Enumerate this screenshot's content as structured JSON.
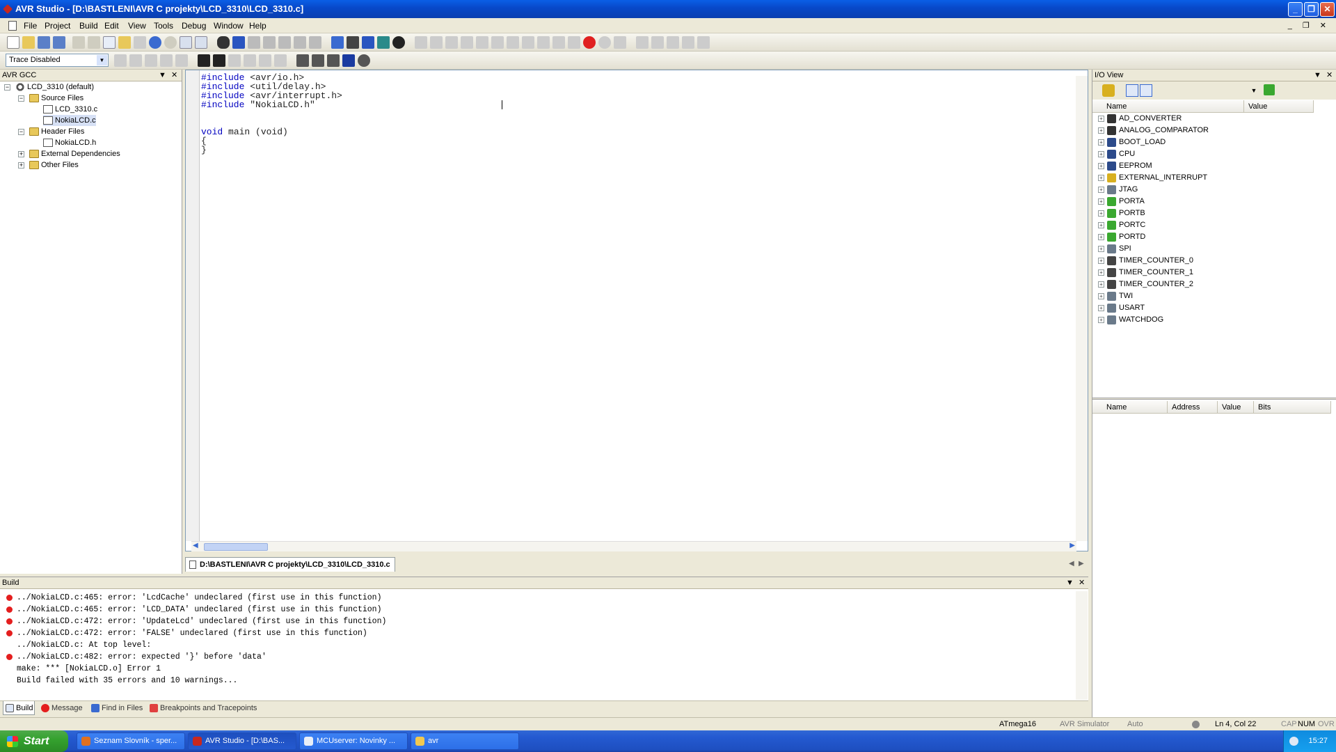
{
  "window": {
    "title": "AVR Studio - [D:\\BASTLENI\\AVR C projekty\\LCD_3310\\LCD_3310.c]",
    "min_label": "_",
    "max_label": "❐",
    "close_label": "✕"
  },
  "menu": [
    "File",
    "Project",
    "Build",
    "Edit",
    "View",
    "Tools",
    "Debug",
    "Window",
    "Help"
  ],
  "doc_controls": "_ ❐ ✕",
  "toolbar": {
    "trace_value": "Trace Disabled"
  },
  "left_panel": {
    "title": "AVR GCC",
    "tree": {
      "project": "LCD_3310 (default)",
      "source_folder": "Source Files",
      "source_files": [
        "LCD_3310.c",
        "NokiaLCD.c"
      ],
      "header_folder": "Header Files",
      "header_files": [
        "NokiaLCD.h"
      ],
      "external_deps": "External Dependencies",
      "other_files": "Other Files"
    }
  },
  "editor": {
    "lines": [
      {
        "kw": "#include",
        "rest": " <avr/io.h>"
      },
      {
        "kw": "#include",
        "rest": " <util/delay.h>"
      },
      {
        "kw": "#include",
        "rest": " <avr/interrupt.h>"
      },
      {
        "kw": "#include",
        "rest": " \"NokiaLCD.h\""
      },
      {
        "kw": "",
        "rest": ""
      },
      {
        "kw": "",
        "rest": ""
      },
      {
        "kw": "void",
        "rest": " main (void)"
      },
      {
        "kw": "",
        "rest": "{"
      },
      {
        "kw": "",
        "rest": "}"
      }
    ],
    "tab_label": "D:\\BASTLENI\\AVR C projekty\\LCD_3310\\LCD_3310.c"
  },
  "io_view": {
    "title": "I/O View",
    "col_name": "Name",
    "col_value": "Value",
    "items": [
      {
        "name": "AD_CONVERTER",
        "icon": "ad-converter-icon",
        "color": "#333333"
      },
      {
        "name": "ANALOG_COMPARATOR",
        "icon": "comparator-icon",
        "color": "#333333"
      },
      {
        "name": "BOOT_LOAD",
        "icon": "boot-load-icon",
        "color": "#2c4a8a"
      },
      {
        "name": "CPU",
        "icon": "cpu-icon",
        "color": "#2c4a8a"
      },
      {
        "name": "EEPROM",
        "icon": "eeprom-icon",
        "color": "#2c4a8a"
      },
      {
        "name": "EXTERNAL_INTERRUPT",
        "icon": "interrupt-icon",
        "color": "#d8b020"
      },
      {
        "name": "JTAG",
        "icon": "jtag-icon",
        "color": "#6a7a8a"
      },
      {
        "name": "PORTA",
        "icon": "port-icon",
        "color": "#3aa830"
      },
      {
        "name": "PORTB",
        "icon": "port-icon",
        "color": "#3aa830"
      },
      {
        "name": "PORTC",
        "icon": "port-icon",
        "color": "#3aa830"
      },
      {
        "name": "PORTD",
        "icon": "port-icon",
        "color": "#3aa830"
      },
      {
        "name": "SPI",
        "icon": "spi-icon",
        "color": "#6a7a8a"
      },
      {
        "name": "TIMER_COUNTER_0",
        "icon": "timer-icon",
        "color": "#444444"
      },
      {
        "name": "TIMER_COUNTER_1",
        "icon": "timer-icon",
        "color": "#444444"
      },
      {
        "name": "TIMER_COUNTER_2",
        "icon": "timer-icon",
        "color": "#444444"
      },
      {
        "name": "TWI",
        "icon": "twi-icon",
        "color": "#6a7a8a"
      },
      {
        "name": "USART",
        "icon": "usart-icon",
        "color": "#6a7a8a"
      },
      {
        "name": "WATCHDOG",
        "icon": "watchdog-icon",
        "color": "#6a7a8a"
      }
    ],
    "reg_cols": [
      "Name",
      "Address",
      "Value",
      "Bits"
    ]
  },
  "build": {
    "title": "Build",
    "lines": [
      {
        "error": true,
        "text": "../NokiaLCD.c:465: error: 'LcdCache' undeclared (first use in this function)"
      },
      {
        "error": true,
        "text": "../NokiaLCD.c:465: error: 'LCD_DATA' undeclared (first use in this function)"
      },
      {
        "error": true,
        "text": "../NokiaLCD.c:472: error: 'UpdateLcd' undeclared (first use in this function)"
      },
      {
        "error": true,
        "text": "../NokiaLCD.c:472: error: 'FALSE' undeclared (first use in this function)"
      },
      {
        "error": false,
        "text": "../NokiaLCD.c: At top level:"
      },
      {
        "error": true,
        "text": "../NokiaLCD.c:482: error: expected '}' before 'data'"
      },
      {
        "error": false,
        "text": "make: *** [NokiaLCD.o] Error 1"
      },
      {
        "error": false,
        "text": "Build failed with 35 errors and 10 warnings..."
      }
    ],
    "tabs": [
      "Build",
      "Message",
      "Find in Files",
      "Breakpoints and Tracepoints"
    ]
  },
  "status": {
    "device": "ATmega16",
    "platform": "AVR Simulator",
    "mode": "Auto",
    "position": "Ln 4, Col 22",
    "cap": "CAP",
    "num": "NUM",
    "ovr": "OVR"
  },
  "taskbar": {
    "start": "Start",
    "tasks": [
      {
        "label": "Seznam Slovník - sper...",
        "color": "#e07020"
      },
      {
        "label": "AVR Studio - [D:\\BAS...",
        "color": "#c8281e"
      },
      {
        "label": "MCUserver: Novinky ...",
        "color": "#e8eef8"
      },
      {
        "label": "avr",
        "color": "#f0c850"
      }
    ],
    "clock": "15:27"
  }
}
